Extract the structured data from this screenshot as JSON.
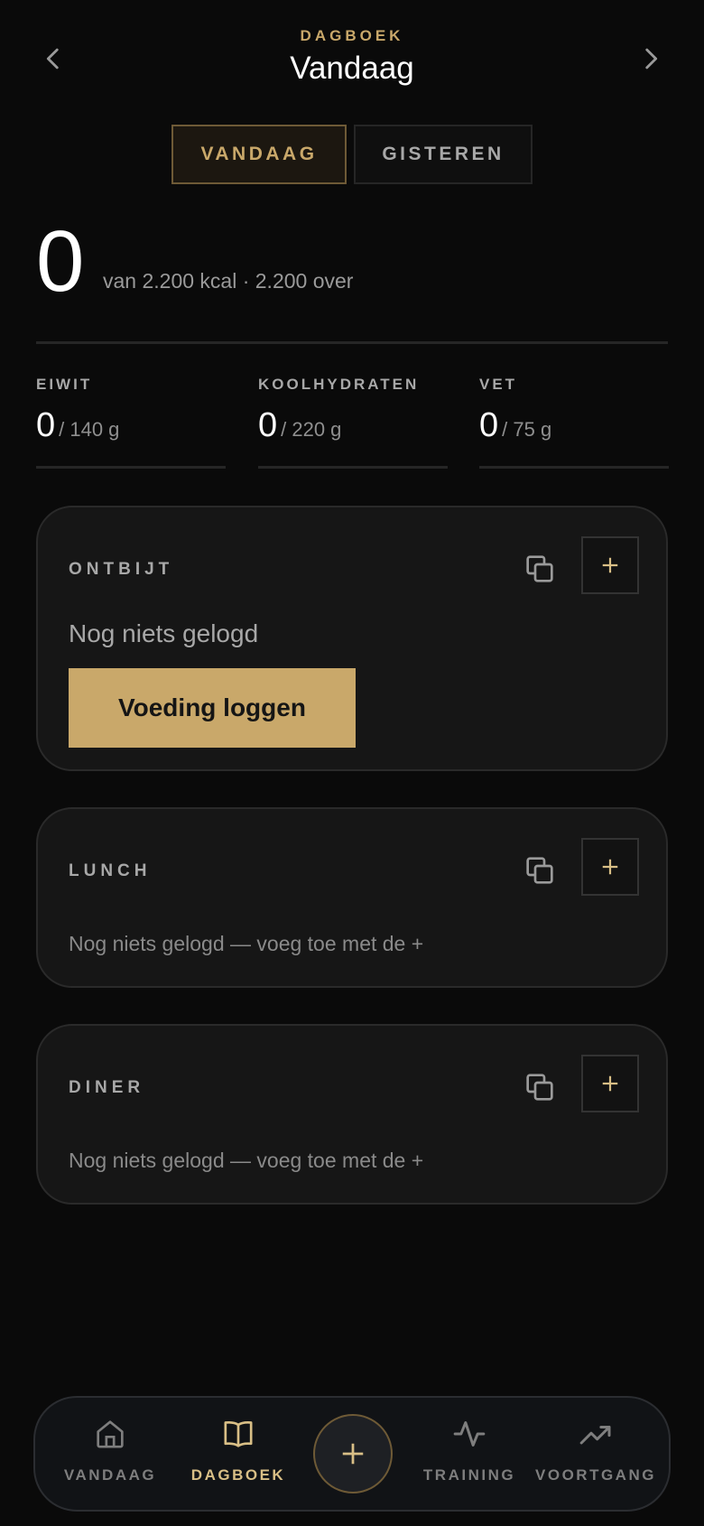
{
  "header": {
    "eyebrow": "DAGBOEK",
    "title": "Vandaag",
    "prev_icon": "chevron-left-icon",
    "next_icon": "chevron-right-icon"
  },
  "day_toggle": {
    "options": [
      "VANDAAG",
      "GISTEREN"
    ],
    "selected": "VANDAAG"
  },
  "calories": {
    "consumed": "0",
    "summary": "van 2.200 kcal · 2.200 over"
  },
  "macros": [
    {
      "label": "EIWIT",
      "value": "0",
      "goal": "/ 140 g",
      "progress": 0
    },
    {
      "label": "KOOLHYDRATEN",
      "value": "0",
      "goal": "/ 220 g",
      "progress": 0
    },
    {
      "label": "VET",
      "value": "0",
      "goal": "/ 75 g",
      "progress": 0
    }
  ],
  "meals": [
    {
      "title": "ONTBIJT",
      "empty_text": "Nog niets gelogd",
      "button": "Voeding loggen"
    },
    {
      "title": "LUNCH",
      "empty_text": "Nog niets gelogd — voeg toe met de +"
    },
    {
      "title": "DINER",
      "empty_text": "Nog niets gelogd — voeg toe met de +"
    }
  ],
  "bottom_nav": {
    "tabs": [
      {
        "label": "VANDAAG",
        "icon": "home-icon"
      },
      {
        "label": "DAGBOEK",
        "icon": "book-icon"
      },
      {
        "label": "TRAINING",
        "icon": "activity-icon"
      },
      {
        "label": "VOORTGANG",
        "icon": "trending-up-icon"
      }
    ],
    "active": "DAGBOEK",
    "fab_icon": "plus-icon"
  },
  "colors": {
    "background": "#0a0a0a",
    "accent": "#c9a86a",
    "card": "#161616",
    "muted_text": "#a8a8a8"
  }
}
